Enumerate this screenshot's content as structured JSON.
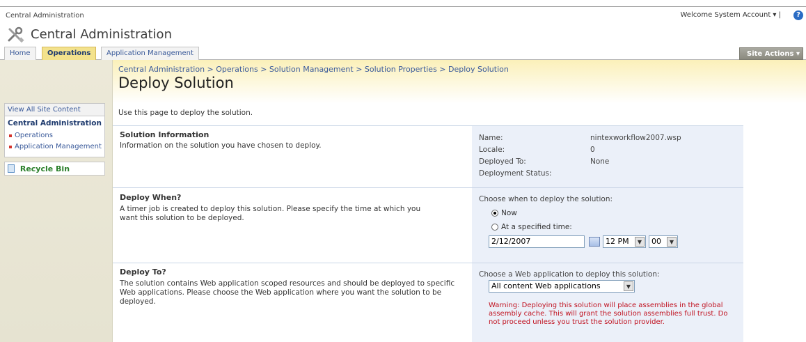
{
  "global": {
    "site_name": "Central Administration",
    "welcome": "Welcome System Account ▾ |",
    "help": "?"
  },
  "header": {
    "site_title": "Central Administration"
  },
  "tabs": [
    {
      "label": "Home"
    },
    {
      "label": "Operations"
    },
    {
      "label": "Application Management"
    }
  ],
  "site_actions": "Site Actions ▾",
  "breadcrumb": "Central Administration > Operations > Solution Management > Solution Properties > Deploy Solution",
  "page_title": "Deploy Solution",
  "nav": {
    "view_all": "View All Site Content",
    "section_title": "Central Administration",
    "items": [
      {
        "label": "Operations"
      },
      {
        "label": "Application Management"
      }
    ],
    "recycle": "Recycle Bin"
  },
  "intro": "Use this page to deploy the solution.",
  "solution_info": {
    "title": "Solution Information",
    "desc": "Information on the solution you have chosen to deploy.",
    "name_label": "Name:",
    "name_value": "nintexworkflow2007.wsp",
    "locale_label": "Locale:",
    "locale_value": "0",
    "deployed_to_label": "Deployed To:",
    "deployed_to_value": "None",
    "status_label": "Deployment Status:"
  },
  "deploy_when": {
    "title": "Deploy When?",
    "desc": "A timer job is created to deploy this solution. Please specify the time at which you want this solution to be deployed.",
    "prompt": "Choose when to deploy the solution:",
    "option_now": "Now",
    "option_specified": "At a specified time:",
    "date_value": "2/12/2007",
    "hour_value": "12 PM",
    "minute_value": "00"
  },
  "deploy_to": {
    "title": "Deploy To?",
    "desc": "The solution contains Web application scoped resources and should be deployed to specific Web applications. Please choose the Web application where you want the solution to be deployed.",
    "prompt": "Choose a Web application to deploy this solution:",
    "select_value": "All content Web applications",
    "warning": "Warning: Deploying this solution will place assemblies in the global assembly cache. This will grant the solution assemblies full trust. Do not proceed unless you trust the solution provider."
  }
}
